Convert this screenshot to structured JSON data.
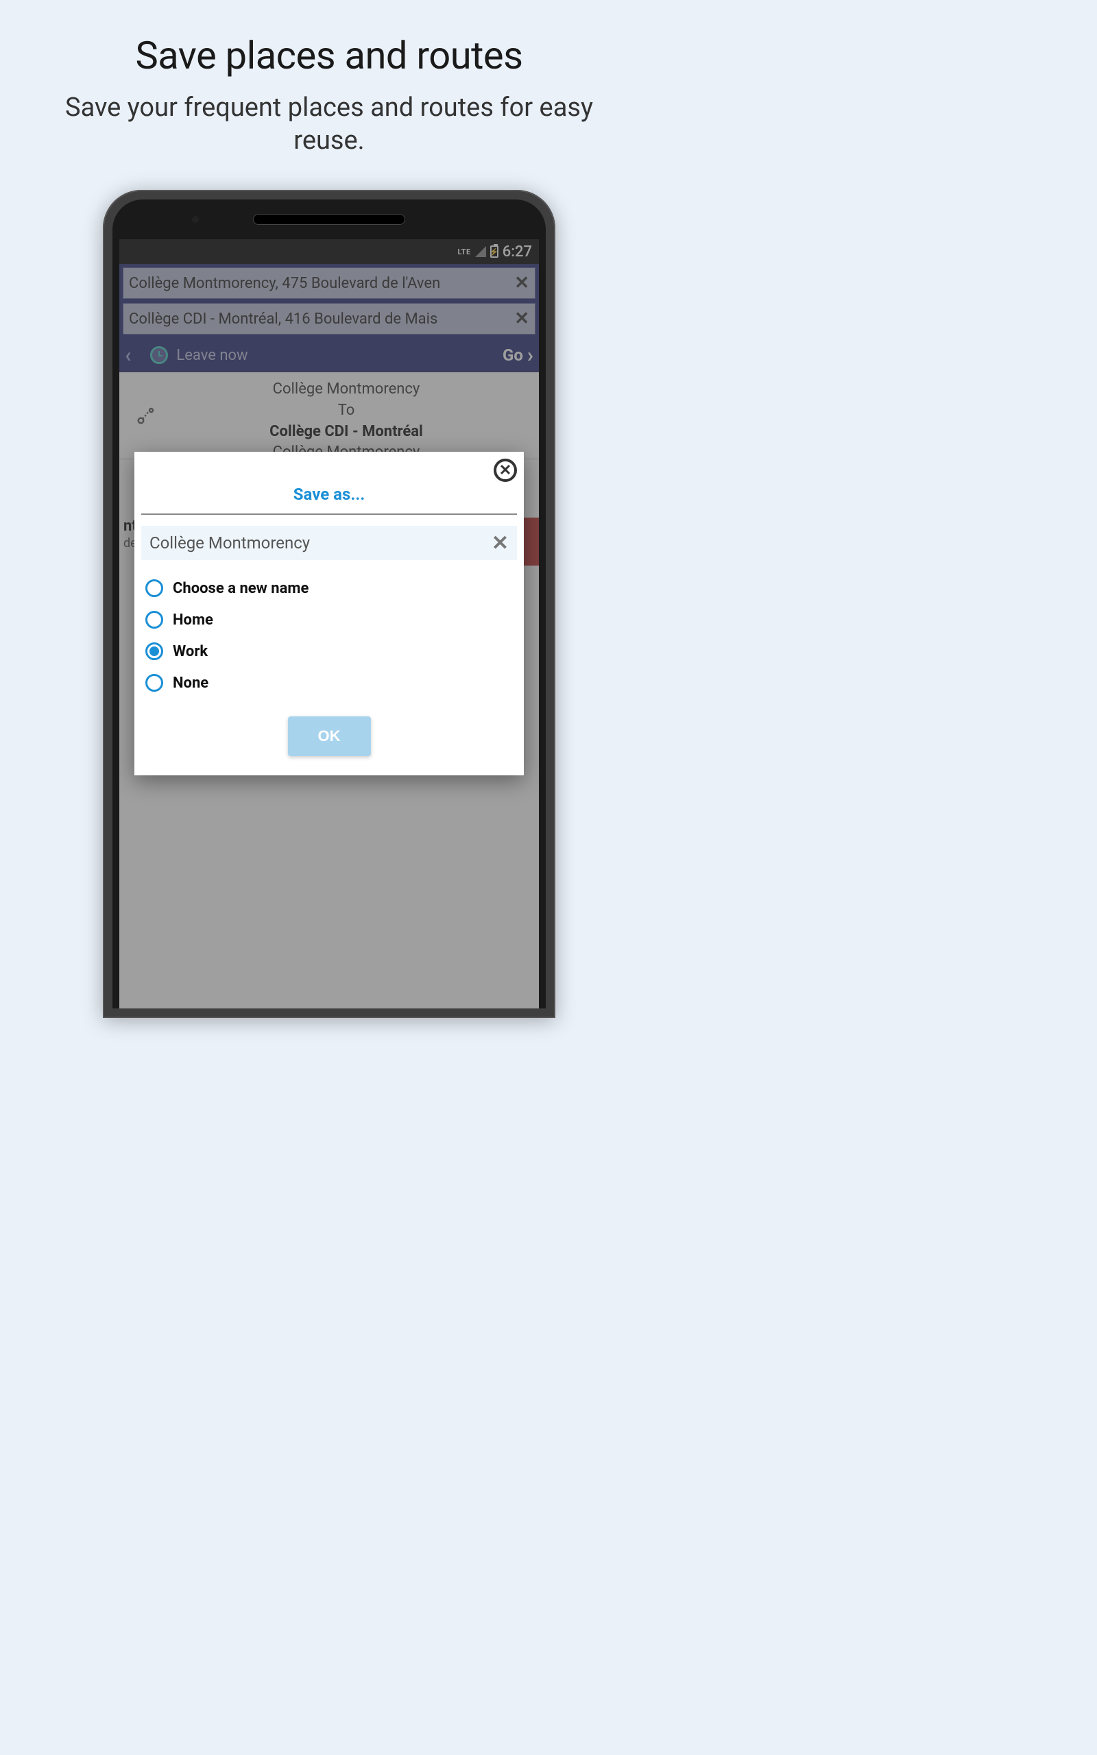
{
  "promo": {
    "title": "Save places and routes",
    "subtitle": "Save your frequent places and routes for easy reuse."
  },
  "status": {
    "network": "LTE",
    "time": "6:27"
  },
  "nav": {
    "from": "Collège Montmorency, 475 Boulevard de l'Aven",
    "to": "Collège CDI - Montréal, 416 Boulevard de Mais",
    "time_label": "Leave now",
    "go": "Go"
  },
  "route": {
    "from": "Collège Montmorency",
    "to_label": "To",
    "to": "Collège CDI - Montréal",
    "peek": "Collège Montmorency"
  },
  "bg_partial": {
    "ntr": "ntr",
    "de": "de"
  },
  "modal": {
    "title": "Save as...",
    "input_value": "Collège Montmorency",
    "ok": "OK",
    "options": {
      "choose": "Choose a new name",
      "home": "Home",
      "work": "Work",
      "none": "None"
    },
    "selected": "work"
  }
}
